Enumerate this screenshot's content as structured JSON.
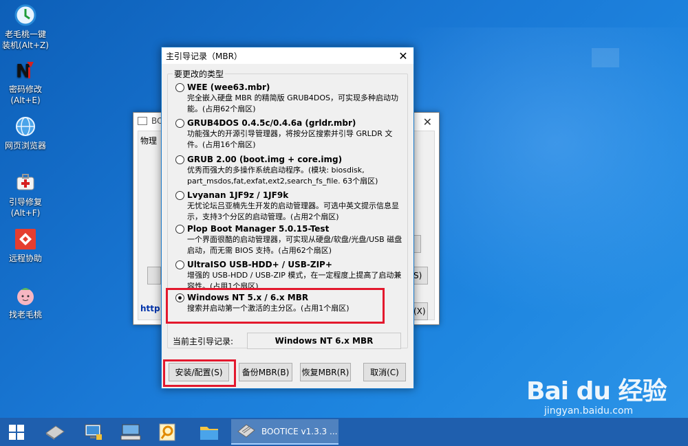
{
  "desktop": {
    "icons": [
      {
        "label": "老毛桃一键\n装机(Alt+Z)",
        "icon": "install-icon"
      },
      {
        "label": "密码修改\n(Alt+E)",
        "icon": "password-icon"
      },
      {
        "label": "网页浏览器",
        "icon": "browser-icon"
      },
      {
        "label": "引导修复\n(Alt+F)",
        "icon": "boot-repair-icon"
      },
      {
        "label": "远程协助",
        "icon": "remote-icon"
      },
      {
        "label": "找老毛桃",
        "icon": "peach-icon"
      }
    ]
  },
  "back_window": {
    "title": "BOOTICE",
    "tab": "物理",
    "link": "http:"
  },
  "dialog": {
    "title": "主引导记录（MBR）",
    "group_label": "要更改的类型",
    "options": [
      {
        "name": "WEE (wee63.mbr)",
        "desc": "完全嵌入硬盘 MBR 的精简版 GRUB4DOS，可实现多种启动功能。(占用62个扇区)",
        "selected": false
      },
      {
        "name": "GRUB4DOS 0.4.5c/0.4.6a (grldr.mbr)",
        "desc": "功能强大的开源引导管理器，将按分区搜索并引导 GRLDR 文件。(占用16个扇区)",
        "selected": false
      },
      {
        "name": "GRUB 2.00 (boot.img + core.img)",
        "desc": "优秀而强大的多操作系统启动程序。(模块: biosdisk, part_msdos,fat,exfat,ext2,search_fs_file. 63个扇区)",
        "selected": false
      },
      {
        "name": "Lvyanan 1JF9z / 1JF9k",
        "desc": "无忧论坛吕亚楠先生开发的启动管理器。可选中英文提示信息显示，支持3个分区的启动管理。(占用2个扇区)",
        "selected": false
      },
      {
        "name": "Plop Boot Manager 5.0.15-Test",
        "desc": "一个界面很酷的启动管理器，可实现从硬盘/软盘/光盘/USB 磁盘启动，而无需 BIOS 支持。(占用62个扇区)",
        "selected": false
      },
      {
        "name": "UltraISO USB-HDD+ / USB-ZIP+",
        "desc": "增强的 USB-HDD / USB-ZIP 模式，在一定程度上提高了启动兼容性。(占用1个扇区)",
        "selected": false
      },
      {
        "name": "Windows NT 5.x / 6.x MBR",
        "desc": "搜索并启动第一个激活的主分区。(占用1个扇区)",
        "selected": true
      }
    ],
    "current_label": "当前主引导记录:",
    "current_value": "Windows NT 6.x MBR",
    "buttons": {
      "install": "安装/配置(S)",
      "backup": "备份MBR(B)",
      "restore": "恢复MBR(R)",
      "cancel": "取消(C)"
    }
  },
  "taskbar": {
    "app_label": "BOOTICE v1.3.3 ..."
  },
  "watermark": {
    "logo": "Bai du 经验",
    "url": "jingyan.baidu.com"
  },
  "colors": {
    "highlight": "#e3182d",
    "taskbar": "#1f5fae",
    "desktop": "#1a79d6"
  }
}
